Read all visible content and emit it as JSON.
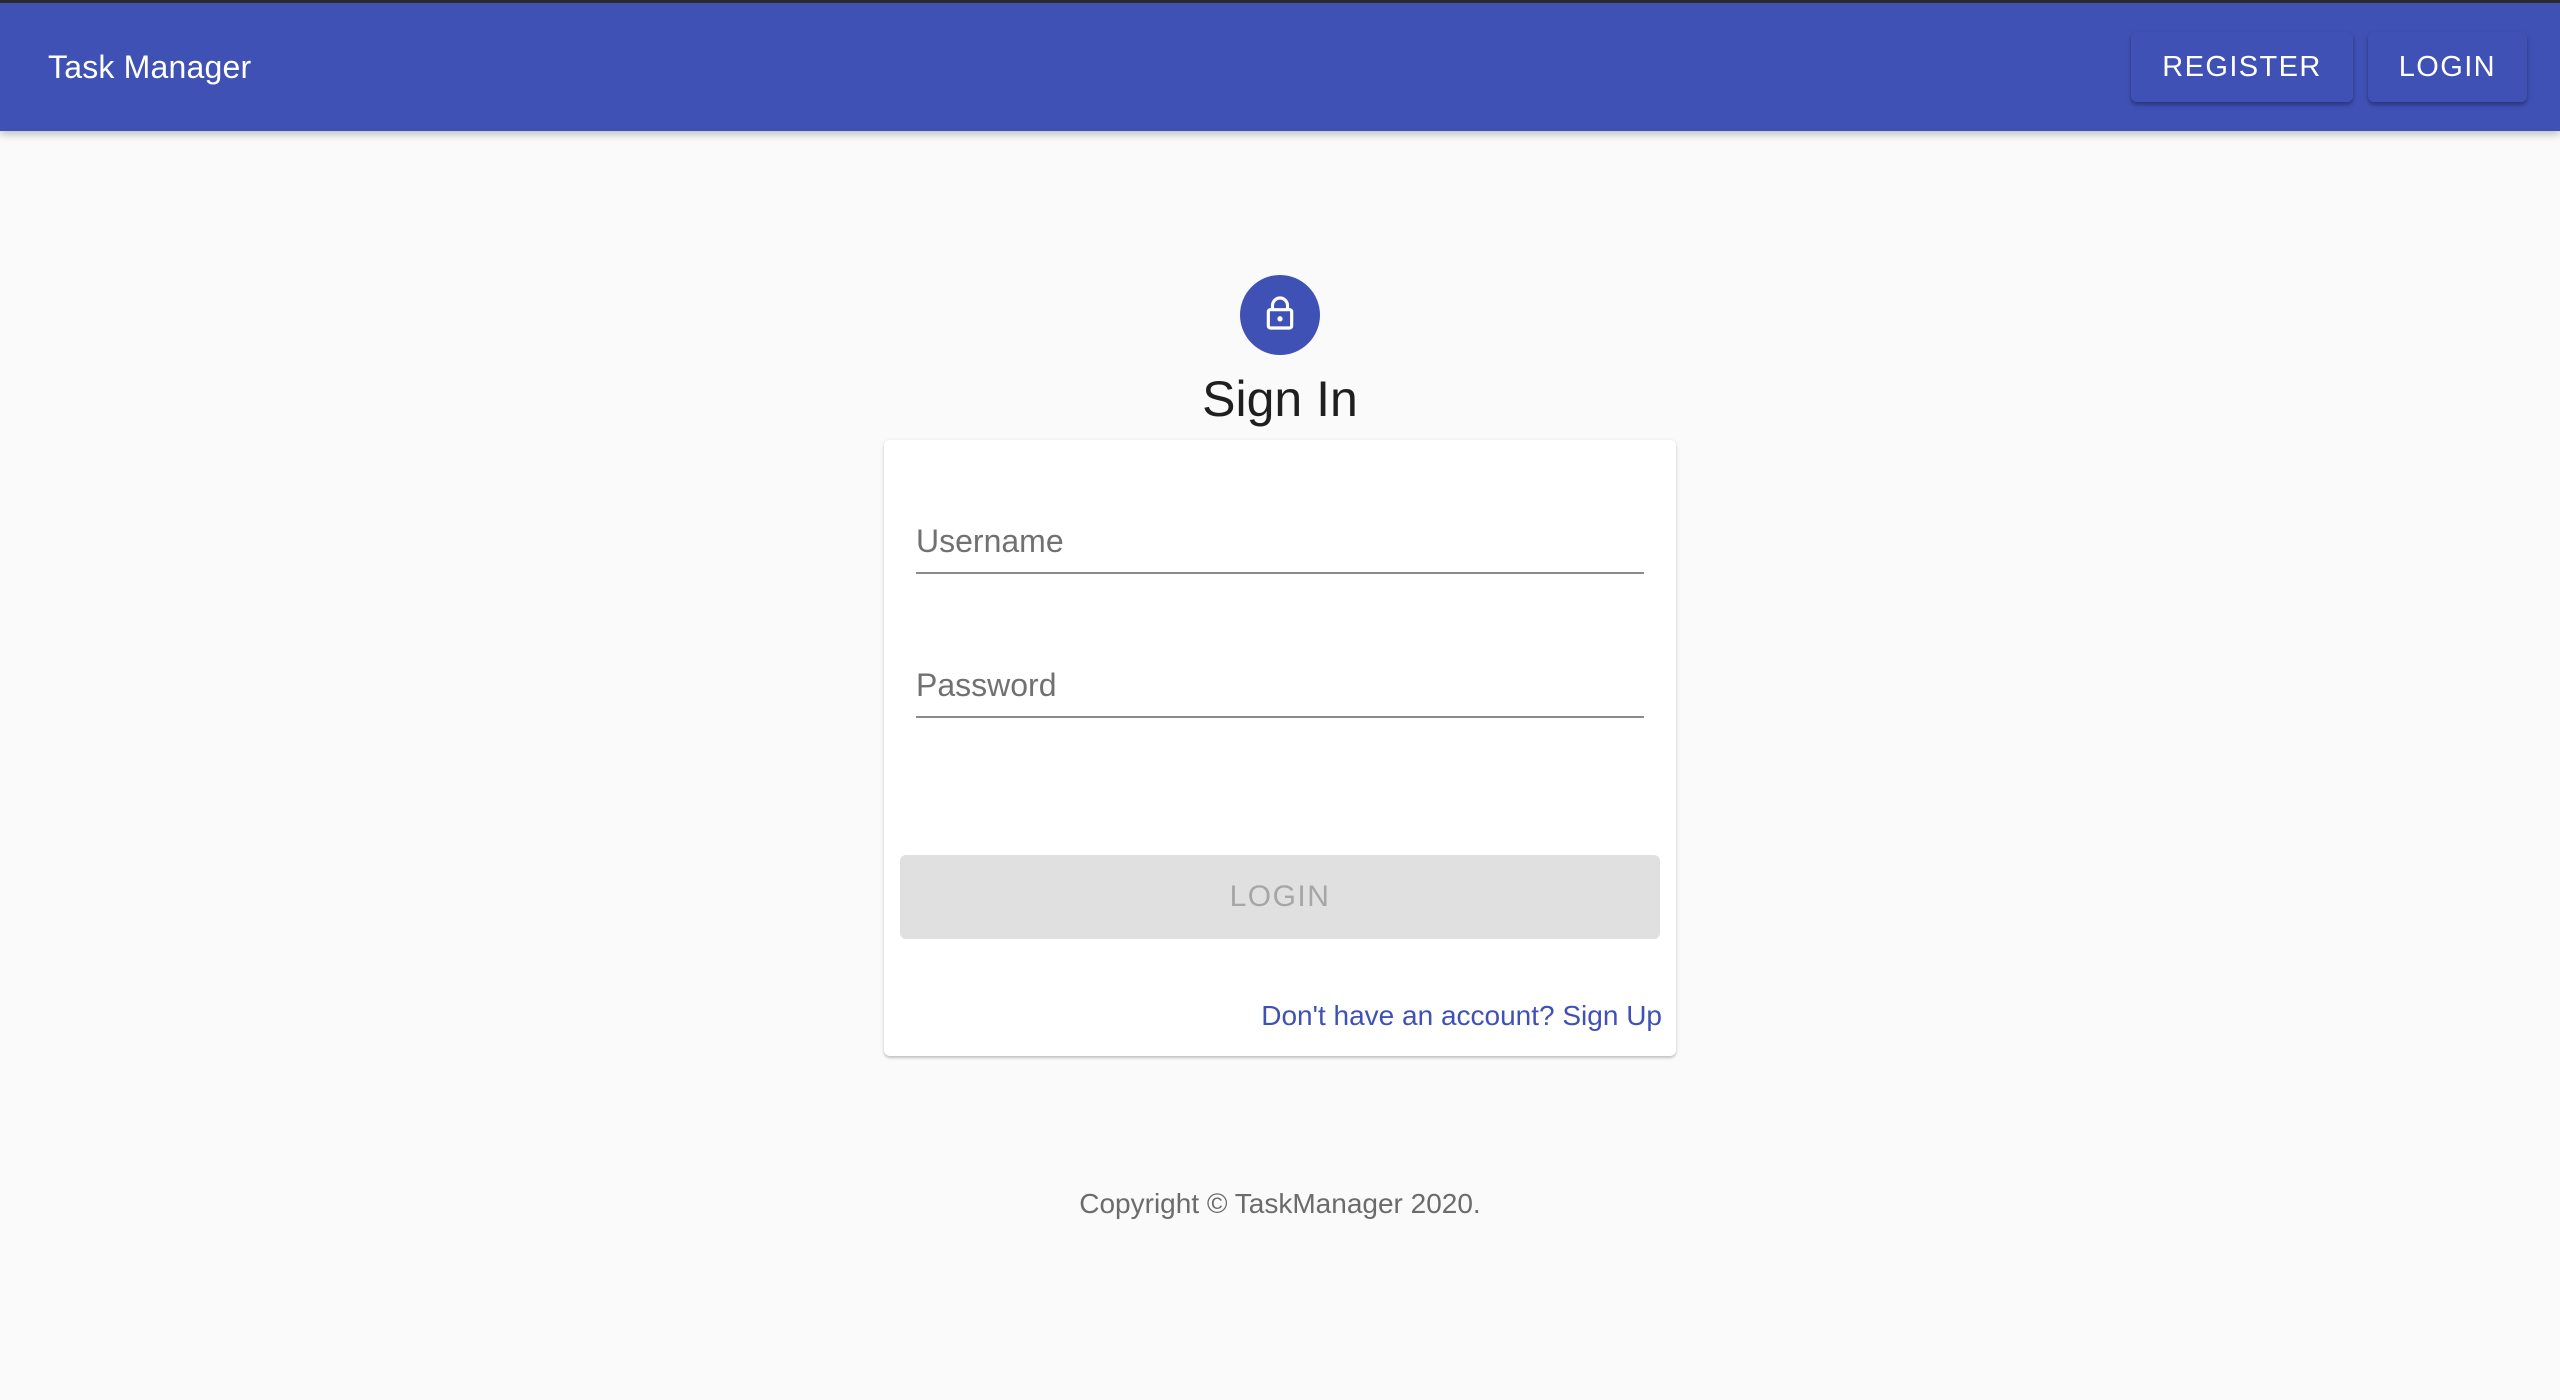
{
  "app": {
    "title": "Task Manager",
    "accent_color": "#3f51b5"
  },
  "nav": {
    "register_label": "REGISTER",
    "login_label": "LOGIN"
  },
  "signin": {
    "icon": "lock-icon",
    "title": "Sign In",
    "username_placeholder": "Username",
    "password_placeholder": "Password",
    "submit_label": "LOGIN",
    "submit_state": "disabled",
    "signup_link": "Don't have an account? Sign Up"
  },
  "footer": {
    "copyright": "Copyright © TaskManager 2020."
  }
}
